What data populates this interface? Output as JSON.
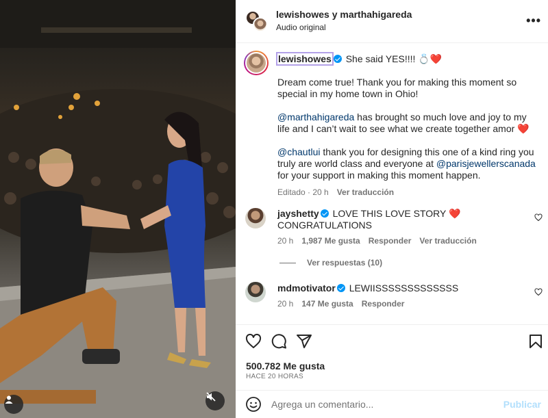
{
  "post": {
    "header": {
      "names": "lewishowes y marthahigareda",
      "audio": "Audio original"
    },
    "caption": {
      "username": "lewishowes",
      "first_line": "She said YES!!!! 💍",
      "heart": "❤️",
      "para1": "Dream come true! Thank you for making this moment so special in my home town in Ohio!",
      "para2_mention": "@marthahigareda",
      "para2_text": " has brought so much love and joy to my life and I can’t wait to see what we create together amor ",
      "para3_mention1": "@chautlui",
      "para3_text1": " thank you for designing this one of a kind ring you truly are world class and everyone at ",
      "para3_mention2": "@parisjewellerscanada",
      "para3_text2": " for your support in making this moment happen.",
      "edited": "Editado · 20 h",
      "see_translation": "Ver traducción"
    },
    "comments": [
      {
        "username": "jayshetty",
        "text": "LOVE THIS LOVE STORY ",
        "heart": "❤️",
        "text2": "CONGRATULATIONS",
        "time": "20 h",
        "likes": "1,987 Me gusta",
        "reply": "Responder",
        "translate": "Ver traducción",
        "view_replies": "Ver respuestas (10)"
      },
      {
        "username": "mdmotivator",
        "text": "LEWIISSSSSSSSSSSSS",
        "time": "20 h",
        "likes": "147 Me gusta",
        "reply": "Responder"
      }
    ],
    "likes": "500.782 Me gusta",
    "time_ago": "HACE 20 HORAS",
    "add_comment": {
      "placeholder": "Agrega un comentario...",
      "publish": "Publicar"
    }
  },
  "colors": {
    "text": "#262626",
    "secondary": "#737373",
    "link": "#00376b",
    "verified": "#0095f6",
    "heart": "#ed1c24",
    "publish_disabled": "#b2dffc"
  },
  "icons": [
    "more-options-icon",
    "verified-badge-icon",
    "heart-outline-icon",
    "comment-icon",
    "share-icon",
    "bookmark-icon",
    "emoji-icon",
    "user-icon",
    "muted-speaker-icon"
  ]
}
